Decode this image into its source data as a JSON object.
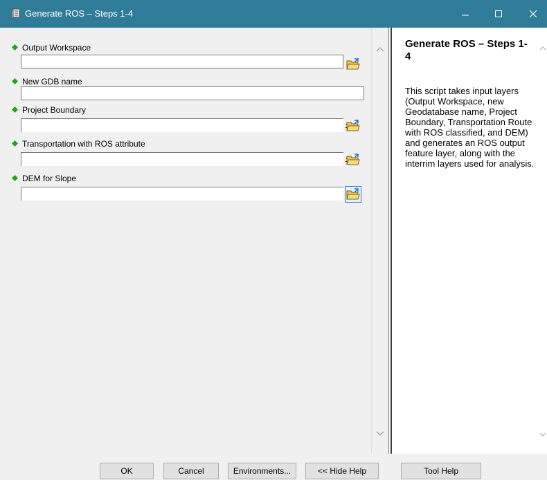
{
  "window": {
    "title": "Generate ROS – Steps 1-4",
    "icon": "script-tool-icon",
    "controls": [
      "minimize-icon",
      "maximize-icon",
      "close-icon"
    ],
    "title_bar_color": "#2f7c99"
  },
  "params": [
    {
      "label": "Output Workspace",
      "type": "folder",
      "value": ""
    },
    {
      "label": "New GDB name",
      "type": "text",
      "value": ""
    },
    {
      "label": "Project Boundary",
      "type": "dropdown",
      "value": ""
    },
    {
      "label": "Transportation with ROS attribute",
      "type": "dropdown",
      "value": ""
    },
    {
      "label": "DEM for Slope",
      "type": "dropdown",
      "value": ""
    }
  ],
  "required_dot_color": "#1fa51f",
  "help": {
    "title": "Generate ROS – Steps 1-4",
    "body": "This script takes input layers (Output Workspace, new Geodatabase name, Project Boundary, Transportation Route with ROS classified, and DEM) and generates an ROS output feature layer, along with the interrim layers used for analysis."
  },
  "buttons": {
    "ok": "OK",
    "cancel": "Cancel",
    "environments": "Environments...",
    "hide_help": "<< Hide Help",
    "tool_help": "Tool Help"
  }
}
